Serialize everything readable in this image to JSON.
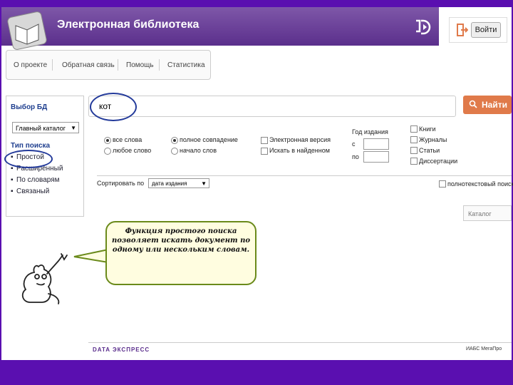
{
  "header": {
    "title": "Электронная библиотека",
    "login_label": "Войти"
  },
  "nav": {
    "items": [
      "О проекте",
      "Обратная связь",
      "Помощь",
      "Статистика"
    ]
  },
  "left_panel": {
    "db_label": "Выбор БД",
    "db_selected": "Главный каталог",
    "search_type_label": "Тип поиска",
    "search_types": [
      "Простой",
      "Расширенный",
      "По словарям",
      "Связаный"
    ]
  },
  "search": {
    "value": "кот",
    "button_label": "Найти"
  },
  "options": {
    "radios_col1": [
      "все слова",
      "любое слово"
    ],
    "radios_col2": [
      "полное совпадение",
      "начало слов"
    ],
    "checks_col3": [
      "Электронная версия",
      "Искать в найденном"
    ],
    "year_label": "Год издания",
    "year_from": "с",
    "year_to": "по",
    "doc_types": [
      "Книги",
      "Журналы",
      "Статьи",
      "Диссертации"
    ]
  },
  "sort": {
    "label": "Сортировать по",
    "selected": "дата издания",
    "fulltext_label": "полнотекстовый поиск"
  },
  "columns_button": "Каталог",
  "callout": {
    "text": "Функция простого поиска позволяет искать документ по одному или нескольким словам."
  },
  "footer": {
    "left_logo": "DATA ЭКСПРЕСС",
    "right_logo": "ИАБС МегаПро"
  }
}
